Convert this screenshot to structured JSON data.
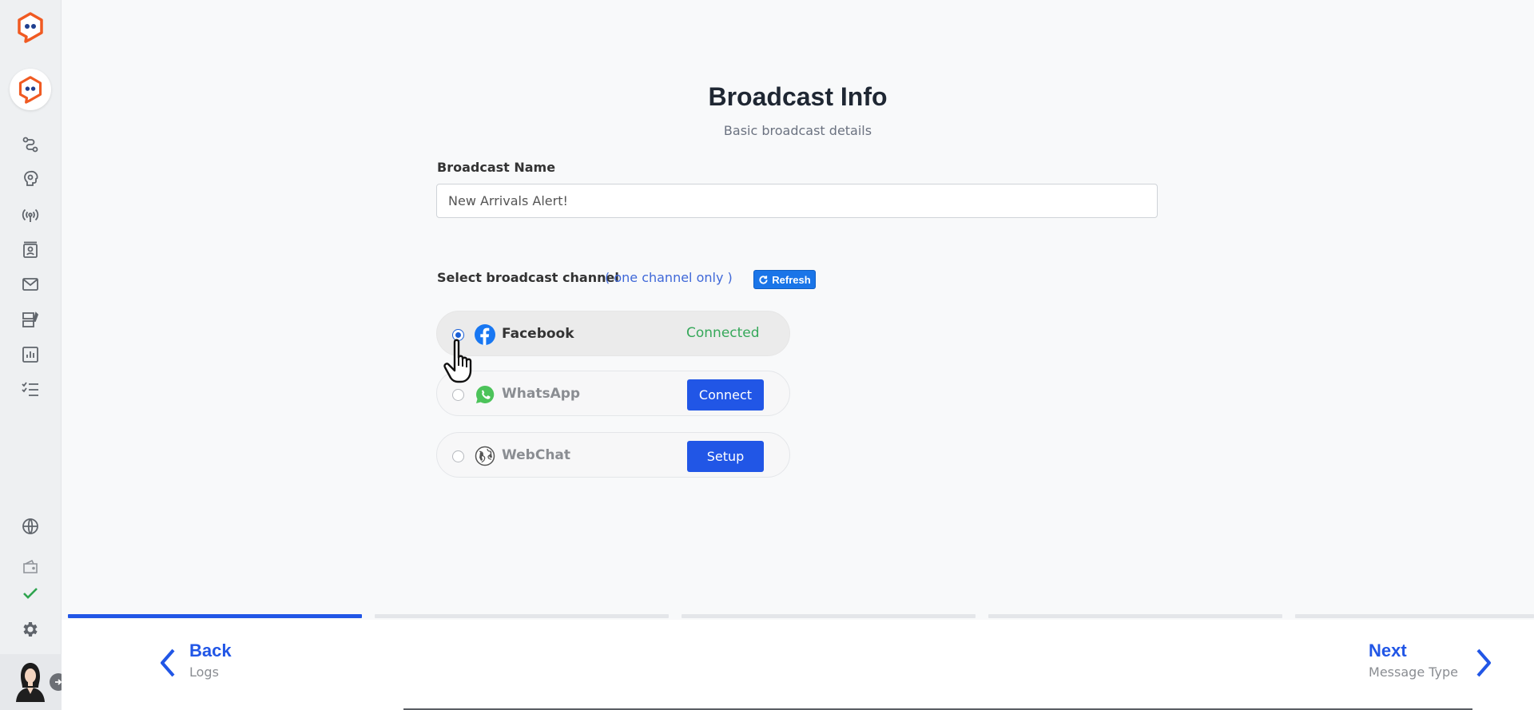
{
  "header": {
    "title": "Broadcast Info",
    "subtitle": "Basic broadcast details"
  },
  "form": {
    "name_label": "Broadcast Name",
    "name_value": "New Arrivals Alert!",
    "channel_label": "Select broadcast channel",
    "channel_hint": "( one channel only )",
    "refresh_label": "Refresh"
  },
  "channels": [
    {
      "name": "Facebook",
      "selected": true,
      "status": "Connected",
      "icon": "facebook-icon"
    },
    {
      "name": "WhatsApp",
      "selected": false,
      "action": "Connect",
      "icon": "whatsapp-icon"
    },
    {
      "name": "WebChat",
      "selected": false,
      "action": "Setup",
      "icon": "globe-icon"
    }
  ],
  "sidebar": {
    "icons": [
      "flow-icon",
      "bot-icon",
      "broadcast-icon",
      "contacts-icon",
      "mail-icon",
      "templates-icon",
      "analytics-icon",
      "tasks-icon",
      "globe-icon",
      "wallet-icon",
      "check-icon",
      "gear-icon"
    ]
  },
  "progress": {
    "steps": 5,
    "current": 1
  },
  "footer": {
    "back_title": "Back",
    "back_sub": "Logs",
    "next_title": "Next",
    "next_sub": "Message Type"
  },
  "colors": {
    "accent": "#2156e6",
    "brand": "#f05a22",
    "connected": "#36a85a",
    "refresh": "#1a75e8"
  }
}
